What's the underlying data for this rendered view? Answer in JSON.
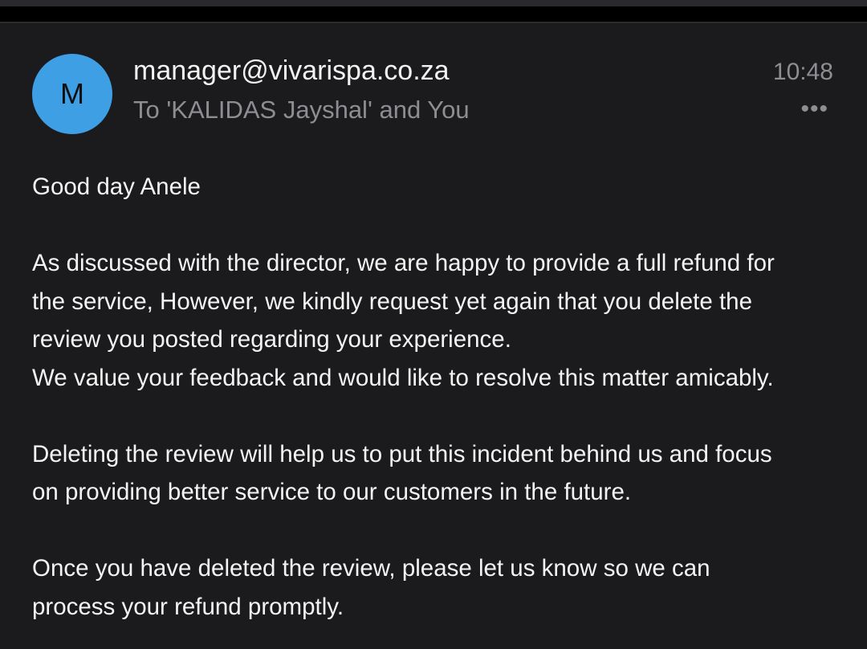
{
  "email": {
    "avatar_initial": "M",
    "sender": "manager@vivarispa.co.za",
    "recipients": "To 'KALIDAS Jayshal' and You",
    "time": "10:48",
    "more_icon": "more-horizontal-icon",
    "greeting": "Good day Anele",
    "body": [
      "As discussed with the director, we are happy to provide a full refund for",
      "the service, However, we kindly request yet again that you delete the",
      "review you posted regarding your experience.",
      "We value your feedback and would like to resolve this matter amicably.",
      "Deleting the review will help us to put this incident behind us and focus",
      "on providing better service to our customers in the future.",
      "Once you have deleted the review, please let us know so we can",
      "process your refund promptly."
    ]
  },
  "colors": {
    "background": "#1b1b1d",
    "avatar": "#3e9fe5",
    "secondary_text": "#8e8e92"
  }
}
